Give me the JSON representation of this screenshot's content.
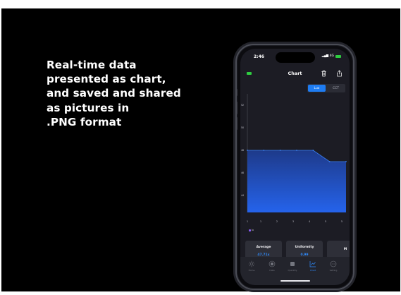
{
  "headline": "Real-time data\npresented as chart,\nand saved and shared\nas pictures in\n.PNG format",
  "status": {
    "time": "2:46",
    "network": "4G"
  },
  "nav": {
    "title": "Chart"
  },
  "segment": {
    "options": [
      "Lux",
      "CCT"
    ],
    "selected": "Lux"
  },
  "chart_data": {
    "type": "area",
    "title": "",
    "xlabel": "",
    "ylabel": "",
    "x_ticks": [
      "1",
      "1",
      "2",
      "3",
      "4",
      "5",
      "5"
    ],
    "y_ticks": [
      "52",
      "50",
      "48",
      "46",
      "44"
    ],
    "ylim": [
      42.5,
      53
    ],
    "series": [
      {
        "name": "lx",
        "color": "#3b82f6",
        "values": [
          48,
          48,
          48,
          48,
          48,
          47,
          47
        ]
      }
    ],
    "grid": false,
    "legend": "bottom-left"
  },
  "stats": [
    {
      "label": "Average",
      "value": "47.71x"
    },
    {
      "label": "Uniformity",
      "value": "0.99"
    },
    {
      "label": "M",
      "value": ""
    }
  ],
  "tabs": [
    {
      "label": "Home",
      "icon": "sun-icon"
    },
    {
      "label": "Data",
      "icon": "record-icon"
    },
    {
      "label": "Quantity",
      "icon": "square-icon"
    },
    {
      "label": "Chart",
      "icon": "chart-icon",
      "active": true
    },
    {
      "label": "Setting",
      "icon": "dots-circle-icon"
    }
  ],
  "colors": {
    "accent": "#1e7cf2",
    "value_text": "#2f8cff",
    "battery": "#2ecc40"
  }
}
